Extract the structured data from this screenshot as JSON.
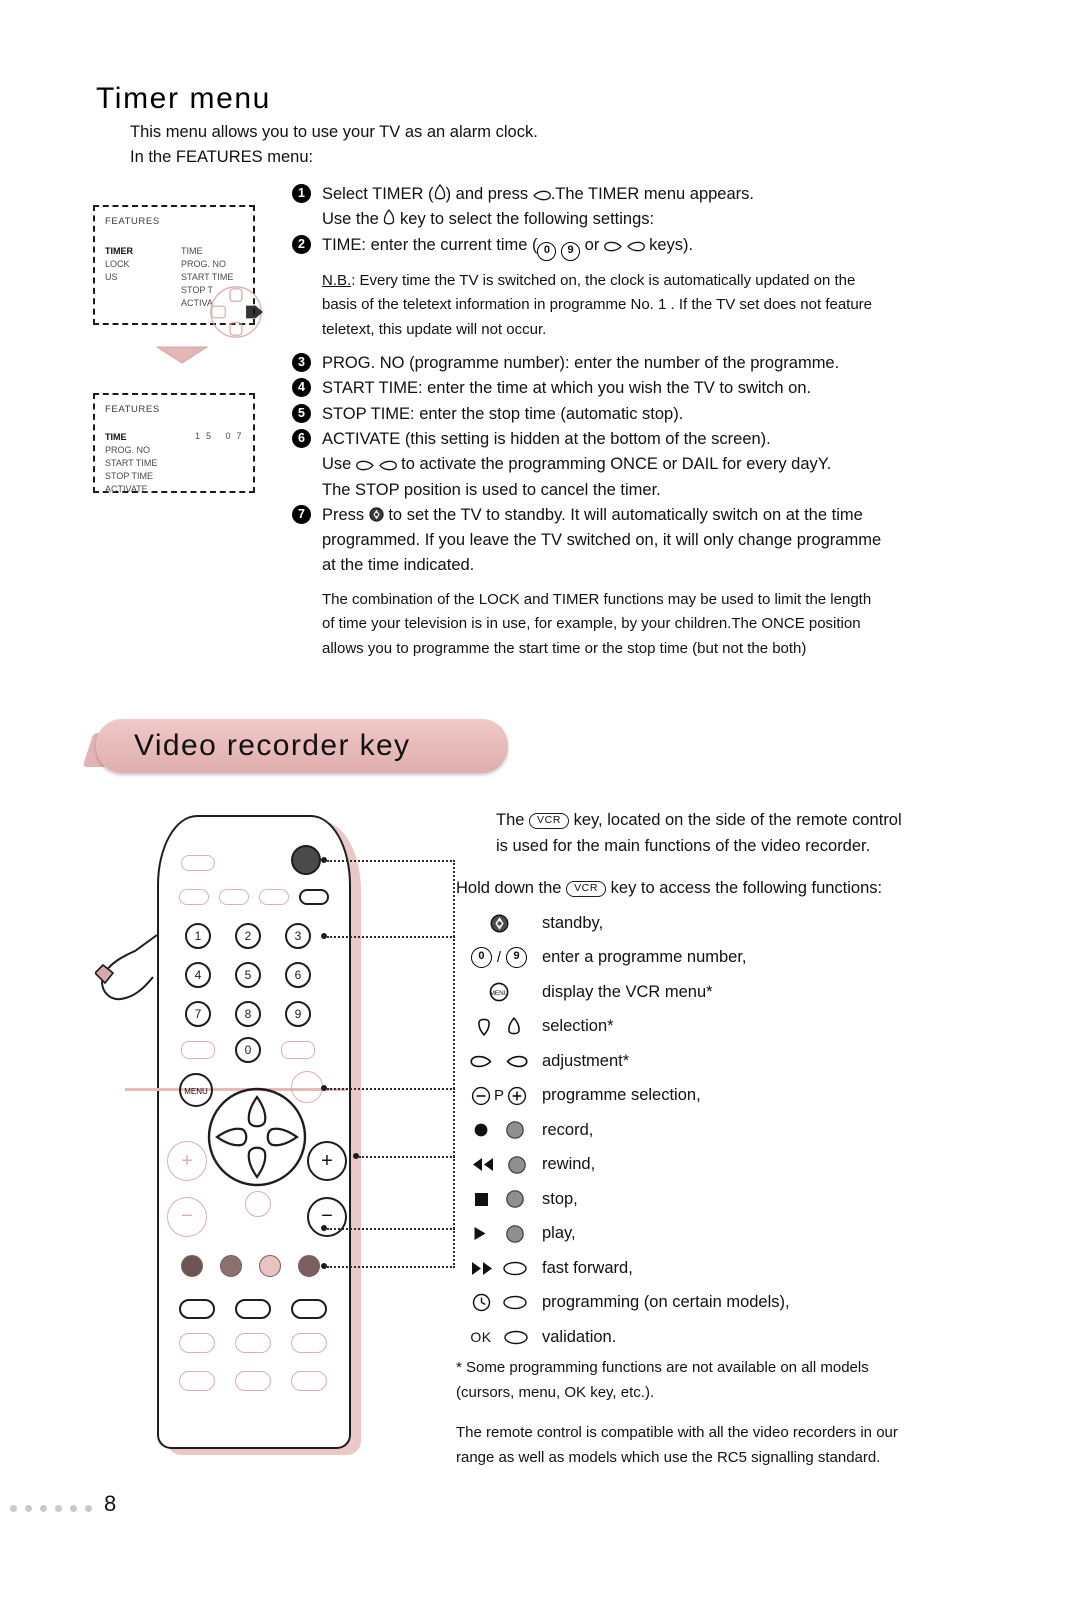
{
  "page": {
    "number": "8",
    "footer_dot_count": 6
  },
  "timer_section": {
    "heading": "Timer menu",
    "intro_lines": [
      "This menu allows you to use your TV as an alarm clock.",
      "In the FEATURES menu:"
    ],
    "steps": [
      {
        "num": "1",
        "pre": "Select TIMER (",
        "icon_1": "up-down-cursor-icon",
        "mid": ") and press ",
        "icon_2": "right-cursor-icon",
        "post": ".The TIMER menu appears.",
        "sub_pre": "Use the ",
        "sub_icon": "up-down-cursor-icon",
        "sub_post": " key to select the following settings:"
      },
      {
        "num": "2",
        "pre": "TIME: enter the current time (",
        "key_0": "0",
        "key_9": "9",
        "mid": " or ",
        "icon_left": "left-cursor-icon",
        "icon_right": "right-cursor-icon",
        "post": " keys)."
      }
    ],
    "nb_label": "N.B.",
    "nb_lines": [
      ": Every time the TV is switched on, the clock is automatically updated on the",
      "basis of the teletext information in programme No. 1 . If the TV set does not feature",
      "teletext, this update will not occur."
    ],
    "steps2": [
      {
        "num": "3",
        "text": "PROG. NO (programme number): enter the number of the programme."
      },
      {
        "num": "4",
        "text": "START TIME: enter the time at which you wish the TV to switch on."
      },
      {
        "num": "5",
        "text": "STOP TIME: enter the stop time (automatic stop)."
      },
      {
        "num": "6",
        "text": "ACTIVATE (this setting is hidden at the bottom of the screen)."
      }
    ],
    "step6_sub_pre": "Use ",
    "step6_sub_post": " to activate the programming ONCE or  DAIL for every dayY.",
    "step6_sub2": "The STOP position is used to cancel the timer.",
    "step7": {
      "num": "7",
      "pre": "Press ",
      "icon": "standby-icon",
      "line1_post": " to set the TV to standby. It will automatically switch on at the time",
      "line2": "programmed. If you leave the TV switched on, it will only change programme",
      "line3": "at the time indicated."
    },
    "closing_lines": [
      "The combination of the LOCK and TIMER functions may be used to limit the length",
      "of time your television is in use, for example, by your children.The ONCE position",
      "allows you to programme the start time or the stop time (but not the both)"
    ]
  },
  "tv_screen_1": {
    "title": "FEATURES",
    "left_items": [
      "TIMER",
      "LOCK",
      "US"
    ],
    "selected_left": "TIMER",
    "right_items": [
      "TIME",
      "PROG. NO",
      "START TIME",
      "STOP T",
      "ACTIVA"
    ]
  },
  "tv_screen_2": {
    "title": "FEATURES",
    "items": [
      "TIME",
      "PROG. NO",
      "START TIME",
      "STOP TIME",
      "ACTIVATE"
    ],
    "selected": "TIME",
    "time_value": "15  07"
  },
  "vcr_section": {
    "banner": "Video recorder key",
    "vcr_key_label": "VCR",
    "paragraph_1": [
      {
        "pre": "The ",
        "key": "VCR",
        "post": " key, located on the side of the remote control"
      },
      {
        "pre": "",
        "key": "",
        "post": "is used for the main functions of the video recorder."
      }
    ],
    "paragraph_2": {
      "pre": "Hold down the ",
      "key": "VCR",
      "post": " key to access the following functions:"
    },
    "functions": [
      {
        "icons": [
          "standby-icon"
        ],
        "label": "standby,"
      },
      {
        "icons": [
          "digit-0-icon",
          "slash",
          "digit-9-icon"
        ],
        "label": "enter a programme number,"
      },
      {
        "icons": [
          "menu-key-icon"
        ],
        "label": "display the VCR menu*"
      },
      {
        "icons": [
          "cursor-up-icon",
          "cursor-down-icon"
        ],
        "label": "selection*"
      },
      {
        "icons": [
          "cursor-left-icon",
          "cursor-right-icon"
        ],
        "label": "adjustment*"
      },
      {
        "icons": [
          "minus-circle-icon",
          "p-label",
          "plus-circle-icon"
        ],
        "label": "programme selection,"
      },
      {
        "icons": [
          "record-dot-icon",
          "grey-key-icon"
        ],
        "label": "record,"
      },
      {
        "icons": [
          "rewind-icon",
          "grey-key-icon"
        ],
        "label": "rewind,"
      },
      {
        "icons": [
          "stop-square-icon",
          "grey-key-icon"
        ],
        "label": "stop,"
      },
      {
        "icons": [
          "play-triangle-icon",
          "grey-key-icon"
        ],
        "label": "play,"
      },
      {
        "icons": [
          "fast-forward-icon",
          "oval-key-icon"
        ],
        "label": "fast forward,"
      },
      {
        "icons": [
          "clock-icon",
          "oval-key-icon"
        ],
        "label": "programming (on certain models),"
      },
      {
        "icons": [
          "ok-label",
          "oval-key-icon"
        ],
        "label": "validation."
      }
    ],
    "p_label": "P",
    "ok_label": "OK",
    "footnote_lines": [
      "*  Some programming functions are not available on all models",
      "(cursors, menu, OK key, etc.)."
    ],
    "compat_lines": [
      "The remote control is compatible with all the video recorders in our",
      "range as well as models which use the RC5 signalling standard."
    ]
  },
  "remote": {
    "numeric_keys": [
      "1",
      "2",
      "3",
      "4",
      "5",
      "6",
      "7",
      "8",
      "9",
      "0"
    ],
    "menu_key_label": "MENU",
    "colors": {
      "accent_pink": "#e0aeae",
      "banner_pink": "#e9bcbc",
      "ink": "#111111"
    }
  }
}
